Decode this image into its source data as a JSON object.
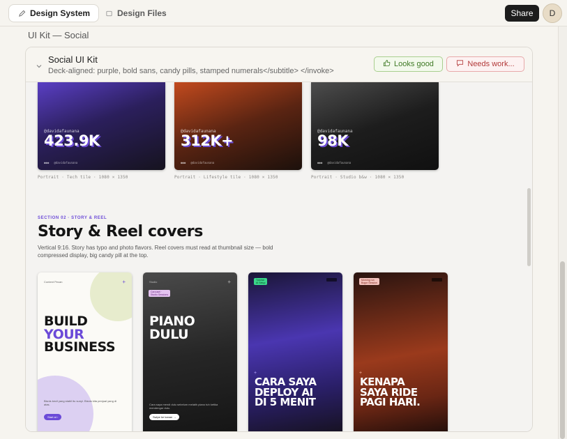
{
  "tabs": [
    {
      "label": "Design System",
      "active": true,
      "icon": "pen-icon"
    },
    {
      "label": "Design Files",
      "active": false,
      "icon": "file-icon"
    }
  ],
  "header": {
    "share_label": "Share",
    "avatar_initial": "D"
  },
  "breadcrumb": "UI Kit — Social",
  "card": {
    "title": "Social UI Kit",
    "subtitle": "Deck-aligned: purple, bold sans, candy pills, stamped numerals</subtitle> </invoke>",
    "looks_good_label": "Looks good",
    "needs_work_label": "Needs work..."
  },
  "portraits": [
    {
      "handle": "@davidafaunana",
      "value": "423.9K",
      "caption": "Portrait · Tech tile · 1080 × 1350"
    },
    {
      "handle": "@davidafaunana",
      "value": "312K+",
      "caption": "Portrait · Lifestyle tile · 1080 × 1350"
    },
    {
      "handle": "@davidafaunana",
      "value": "98K",
      "caption": "Portrait · Studio b&w · 1080 × 1350"
    }
  ],
  "section": {
    "label": "SECTION 02 · STORY & REEL",
    "title": "Story & Reel covers",
    "description": "Vertical 9:16. Story has typo and photo flavors. Reel covers must read at thumbnail size — bold compressed display, big candy pill at the top."
  },
  "stories": [
    {
      "top_label": "Content Pecan",
      "headline_lines": [
        "BUILD",
        "YOUR",
        "BUSINESS"
      ],
      "cta": "Start at ›"
    },
    {
      "top_label": "Studio",
      "tag": "Carousel ·\nStudio Sessions",
      "headline_lines": [
        "PIANO",
        "DULU"
      ],
      "cta": "Swipe ke kanan →"
    },
    {
      "tag": "Tutorial\nAI Setup",
      "headline_lines": [
        "CARA SAYA",
        "DEPLOY AI",
        "DI 5 MENIT"
      ]
    },
    {
      "tag": "Morning run\nBogor Session",
      "headline_lines": [
        "KENAPA",
        "SAYA RIDE",
        "PAGI HARI."
      ]
    }
  ]
}
